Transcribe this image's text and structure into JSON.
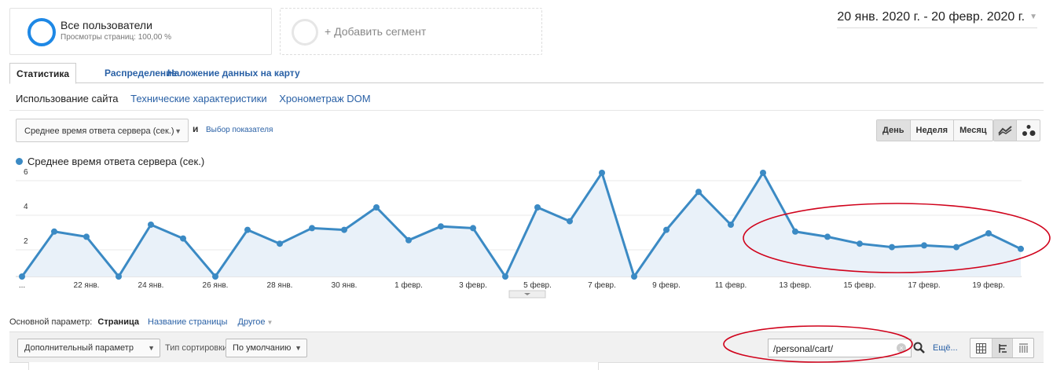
{
  "segments": {
    "active": {
      "title": "Все пользователи",
      "subtitle": "Просмотры страниц: 100,00 %"
    },
    "add_label": "+ Добавить сегмент"
  },
  "date_range": "20 янв. 2020 г. - 20 февр. 2020 г.",
  "tabs": [
    {
      "label": "Статистика",
      "active": true
    },
    {
      "label": "Распределение",
      "active": false
    },
    {
      "label": "Наложение данных на карту",
      "active": false
    }
  ],
  "subtabs": [
    {
      "label": "Использование сайта",
      "active": true
    },
    {
      "label": "Технические характеристики",
      "active": false
    },
    {
      "label": "Хронометраж DOM",
      "active": false
    }
  ],
  "metric_selector": {
    "value": "Среднее время ответа сервера (сек.)",
    "and_label": "и",
    "choose_link": "Выбор показателя"
  },
  "period_buttons": [
    {
      "label": "День",
      "active": true
    },
    {
      "label": "Неделя",
      "active": false
    },
    {
      "label": "Месяц",
      "active": false
    }
  ],
  "view_buttons": [
    {
      "icon": "line-chart-icon",
      "active": true
    },
    {
      "icon": "motion-chart-icon",
      "active": false
    }
  ],
  "chart_data": {
    "type": "area",
    "series": [
      {
        "name": "Среднее время ответа сервера (сек.)",
        "color": "#3b8ac4",
        "values": [
          0,
          2.6,
          2.3,
          0,
          3.0,
          2.2,
          0,
          2.7,
          1.9,
          2.8,
          2.7,
          4.0,
          2.1,
          2.9,
          2.8,
          0,
          4.0,
          3.2,
          6.0,
          0,
          2.7,
          4.9,
          3.0,
          6.0,
          2.6,
          2.3,
          1.9,
          1.7,
          1.8,
          1.7,
          2.5,
          1.6
        ]
      }
    ],
    "x_tick_labels": [
      "...",
      "22 янв.",
      "24 янв.",
      "26 янв.",
      "28 янв.",
      "30 янв.",
      "1 февр.",
      "3 февр.",
      "5 февр.",
      "7 февр.",
      "9 февр.",
      "11 февр.",
      "13 февр.",
      "15 февр.",
      "17 февр.",
      "19 февр."
    ],
    "y_ticks": [
      "2",
      "4",
      "6"
    ],
    "ylim": [
      0,
      6.5
    ],
    "grid": true,
    "legend": "top-left"
  },
  "primary_dimension": {
    "label": "Основной параметр:",
    "active": "Страница",
    "option": "Название страницы",
    "other": "Другое"
  },
  "toolbar": {
    "secondary_dim": "Дополнительный параметр",
    "sort_label": "Тип сортировки:",
    "sort_value": "По умолчанию",
    "search_value": "/personal/cart/",
    "more_link": "Ещё..."
  },
  "colors": {
    "accent": "#3b8ac4",
    "link": "#2a61a6",
    "annotation": "#d0021b"
  }
}
